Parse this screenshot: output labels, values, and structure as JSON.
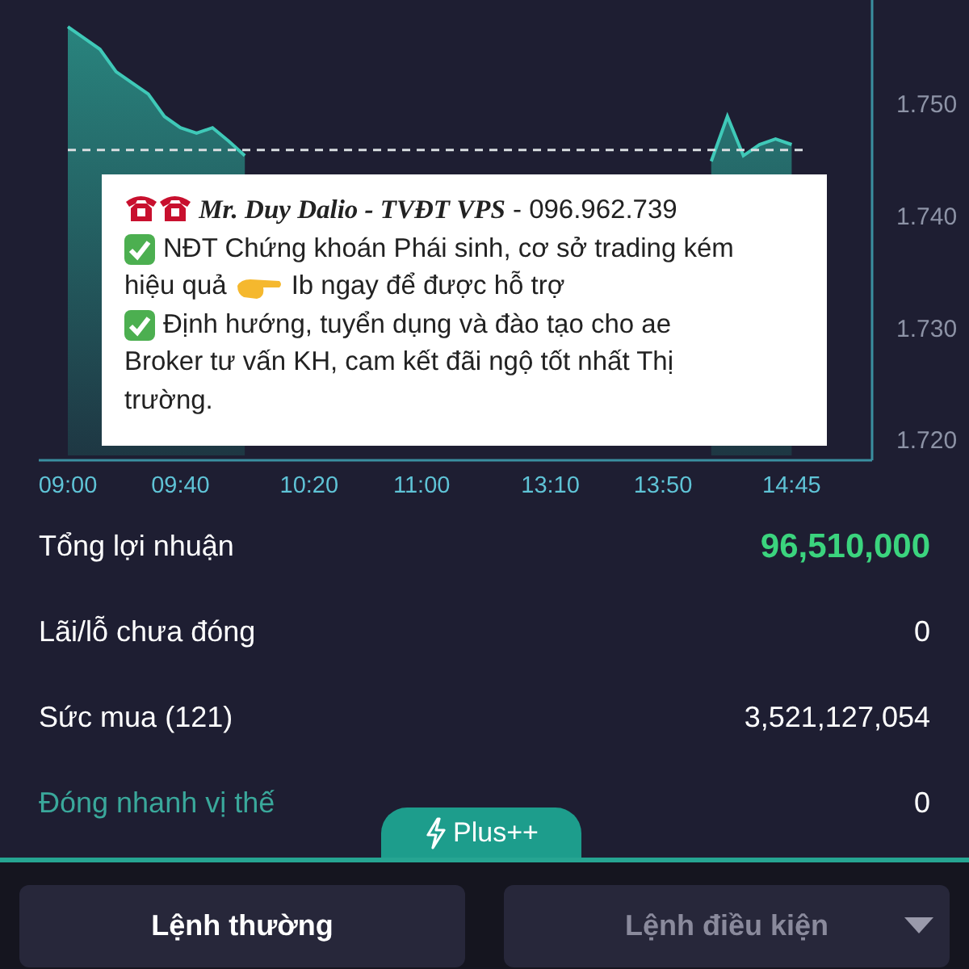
{
  "chart": {
    "chart_data": {
      "type": "area",
      "categories": [
        "09:00",
        null,
        null,
        null,
        null,
        null,
        null,
        "09:40",
        null,
        null,
        null,
        null,
        null,
        null,
        null,
        "10:20",
        null,
        null,
        null,
        null,
        null,
        null,
        "11:00",
        null,
        null,
        null,
        null,
        null,
        null,
        null,
        "13:10",
        null,
        null,
        null,
        null,
        null,
        null,
        "13:50",
        null,
        null,
        null,
        null,
        null,
        null,
        null,
        "14:45",
        null,
        null,
        null,
        null,
        null
      ],
      "series": [
        {
          "color": "#3fc9b8",
          "values": [
            1.757,
            1.756,
            1.755,
            1.753,
            1.752,
            1.751,
            1.749,
            1.748,
            1.7475,
            1.748,
            1.7468,
            1.7455,
            null,
            null,
            null,
            null,
            null,
            null,
            null,
            null,
            null,
            null,
            null,
            null,
            null,
            null,
            null,
            null,
            null,
            null,
            null,
            null,
            null,
            null,
            null,
            null,
            null,
            null,
            null,
            null,
            1.745,
            1.749,
            1.7455,
            1.7465,
            1.747,
            1.7465,
            null,
            null,
            null,
            null,
            null
          ]
        }
      ],
      "yticks": [
        {
          "value": 1.75,
          "label": "1.750"
        },
        {
          "value": 1.74,
          "label": "1.740"
        },
        {
          "value": 1.73,
          "label": "1.730"
        },
        {
          "value": 1.72,
          "label": "1.720"
        }
      ],
      "ylim": [
        1.7183,
        1.7594
      ],
      "ref_lines": [
        {
          "axis": "y",
          "value": 1.746
        }
      ]
    }
  },
  "promo": {
    "name": "Mr. Duy Dalio - TVĐT VPS",
    "phone": " - 096.962.739",
    "lines": [
      {
        "kind": "check",
        "parts": [
          "NĐT Chứng khoán Phái sinh, cơ sở trading kém"
        ]
      },
      {
        "kind": "pointer",
        "parts": [
          "hiệu quả",
          "Ib ngay để được hỗ trợ"
        ]
      },
      {
        "kind": "check",
        "parts": [
          "Định hướng, tuyển dụng và đào tạo cho ae"
        ]
      },
      {
        "kind": "plain",
        "parts": [
          "Broker tư vấn KH, cam kết đãi ngộ tốt nhất Thị"
        ]
      },
      {
        "kind": "plain",
        "parts": [
          "trường."
        ]
      }
    ]
  },
  "stats": [
    {
      "kind": "stat",
      "label": "Tổng lợi nhuận",
      "value": "96,510,000",
      "highlight": true
    },
    {
      "kind": "stat",
      "label": "Lãi/lỗ chưa đóng",
      "value": "0",
      "highlight": false
    },
    {
      "kind": "stat",
      "label": "Sức mua (121)",
      "value": "3,521,127,054",
      "highlight": false
    },
    {
      "kind": "link",
      "label": "Đóng nhanh vị thế",
      "value": "0",
      "highlight": false
    }
  ],
  "plus_tab": {
    "label": "Plus++"
  },
  "order_tabs": [
    {
      "label": "Lệnh thường",
      "selected": true,
      "dropdown": false
    },
    {
      "label": "Lệnh điều kiện",
      "selected": false,
      "dropdown": true
    }
  ]
}
